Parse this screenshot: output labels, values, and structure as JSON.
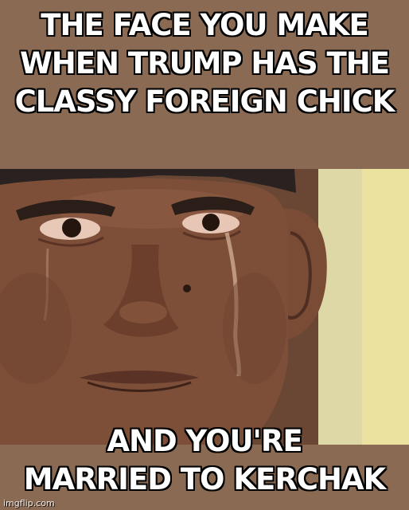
{
  "meme": {
    "top_text": [
      "THE FACE YOU MAKE",
      "WHEN TRUMP HAS THE",
      "CLASSY FOREIGN CHICK"
    ],
    "bottom_text": [
      "AND YOU'RE",
      "MARRIED TO KERCHAK"
    ],
    "watermark": "imgflip.com"
  },
  "colors": {
    "background": "#8a6a53",
    "caption_fill": "#ffffff",
    "caption_outline": "#000000"
  },
  "photo": {
    "subject": "close-up of a crying man's face with tears on cheeks"
  }
}
